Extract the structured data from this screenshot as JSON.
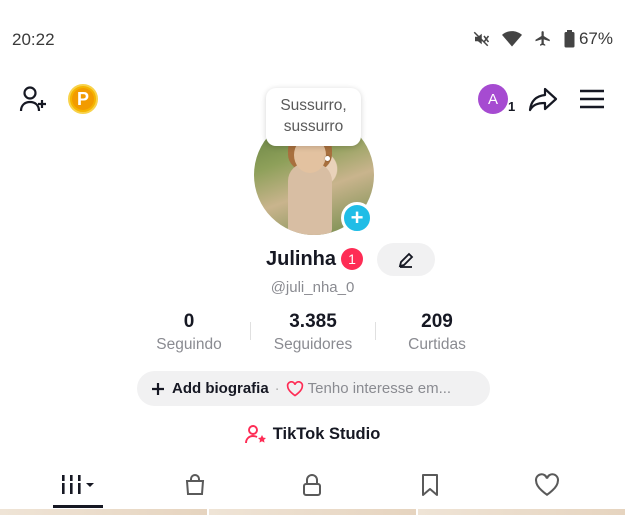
{
  "status_bar": {
    "time": "20:22",
    "icons": [
      "mute-icon",
      "wifi-icon",
      "airplane-icon",
      "battery-icon"
    ],
    "battery": "67%"
  },
  "top_bar": {
    "left_icons": [
      "add-friend-icon",
      "coin-icon"
    ],
    "coin_letter": "P",
    "account_letter": "A",
    "account_count": "1",
    "right_icons": [
      "share-icon",
      "menu-icon"
    ]
  },
  "profile": {
    "bubble_text": "Sussurro, sussurro",
    "name": "Julinha",
    "badge_count": "1",
    "handle": "@juli_nha_0",
    "stats": [
      {
        "value": "0",
        "label": "Seguindo"
      },
      {
        "value": "3.385",
        "label": "Seguidores"
      },
      {
        "value": "209",
        "label": "Curtidas"
      }
    ],
    "bio_add": "Add biografia",
    "bio_interest": "Tenho interesse em...",
    "studio": "TikTok Studio"
  },
  "tabs": [
    "videos-grid-icon",
    "shop-bag-icon",
    "lock-icon",
    "bookmark-icon",
    "heart-icon"
  ],
  "colors": {
    "accent": "#fe2c55",
    "add_photo": "#20bde6",
    "account": "#a64bd1",
    "coin": "#f5b400"
  }
}
